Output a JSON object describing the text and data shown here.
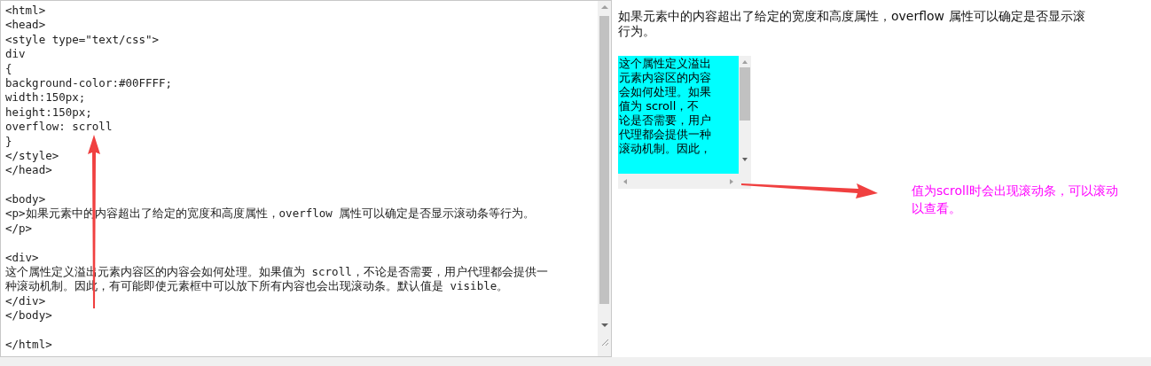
{
  "editor": {
    "lines": [
      {
        "text": "<html>",
        "blank_before": false
      },
      {
        "text": "<head>",
        "blank_before": false
      },
      {
        "text": "<style type=\"text/css\">",
        "blank_before": false
      },
      {
        "text": "div",
        "blank_before": false
      },
      {
        "text": "{",
        "blank_before": false
      },
      {
        "text": "background-color:#00FFFF;",
        "blank_before": false
      },
      {
        "text": "width:150px;",
        "blank_before": false
      },
      {
        "text": "height:150px;",
        "blank_before": false
      },
      {
        "text": "overflow: scroll",
        "blank_before": false
      },
      {
        "text": "}",
        "blank_before": false
      },
      {
        "text": "</style>",
        "blank_before": false
      },
      {
        "text": "</head>",
        "blank_before": false
      },
      {
        "text": "<body>",
        "blank_before": true
      },
      {
        "text": "<p>如果元素中的内容超出了给定的宽度和高度属性，overflow 属性可以确定是否显示滚动条等行为。",
        "blank_before": false
      },
      {
        "text": "</p>",
        "blank_before": false
      },
      {
        "text": "<div>",
        "blank_before": true
      },
      {
        "text": "这个属性定义溢出元素内容区的内容会如何处理。如果值为 scroll，不论是否需要，用户代理都会提供一",
        "blank_before": false
      },
      {
        "text": "种滚动机制。因此，有可能即使元素框中可以放下所有内容也会出现滚动条。默认值是 visible。",
        "blank_before": false
      },
      {
        "text": "</div>",
        "blank_before": false
      },
      {
        "text": "</body>",
        "blank_before": false
      },
      {
        "text": "</html>",
        "blank_before": true
      }
    ]
  },
  "preview": {
    "paragraph_lines": [
      "如果元素中的内容超出了给定的宽度和高度属性，overflow 属性可以确定是否显示滚",
      "行为。"
    ],
    "scroll_box": {
      "lines": [
        "这个属性定义溢出",
        "元素内容区的内容",
        "会如何处理。如果",
        "值为 scroll，不",
        "论是否需要，用户",
        "代理都会提供一种",
        "滚动机制。因此，"
      ]
    }
  },
  "annotation": {
    "text": "值为scroll时会出现滚动条，可以滚动以查看。"
  }
}
